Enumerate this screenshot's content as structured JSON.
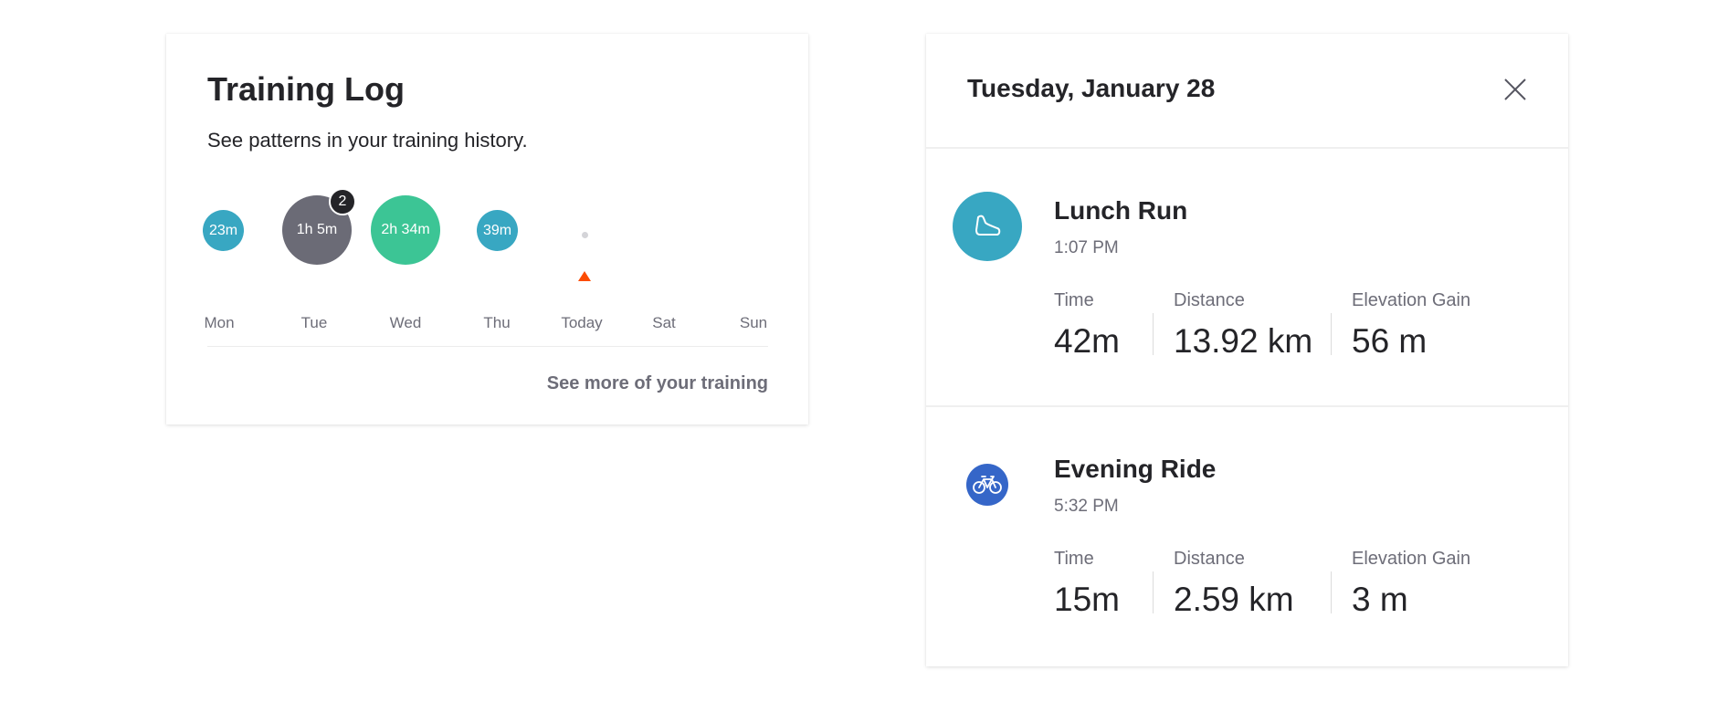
{
  "training_log": {
    "title": "Training Log",
    "subtitle": "See patterns in your training history.",
    "days": [
      {
        "label": "Mon",
        "duration": "23m"
      },
      {
        "label": "Tue",
        "duration": "1h 5m",
        "activity_count": "2"
      },
      {
        "label": "Wed",
        "duration": "2h 34m"
      },
      {
        "label": "Thu",
        "duration": "39m"
      },
      {
        "label": "Today"
      },
      {
        "label": "Sat"
      },
      {
        "label": "Sun"
      }
    ],
    "see_more_label": "See more of your training",
    "colors": {
      "run": "#38a7c2",
      "multi": "#6b6b76",
      "ride_long": "#3cc595",
      "today_marker": "#fc4c02"
    }
  },
  "day_detail": {
    "date": "Tuesday, January 28",
    "close_icon": "close-icon",
    "activities": [
      {
        "name": "Lunch Run",
        "time": "1:07 PM",
        "icon": "shoe-icon",
        "icon_color": "#38a7c2",
        "stats": [
          {
            "label": "Time",
            "value": "42m"
          },
          {
            "label": "Distance",
            "value": "13.92 km"
          },
          {
            "label": "Elevation Gain",
            "value": "56 m"
          }
        ]
      },
      {
        "name": "Evening Ride",
        "time": "5:32 PM",
        "icon": "bicycle-icon",
        "icon_color": "#3566c8",
        "stats": [
          {
            "label": "Time",
            "value": "15m"
          },
          {
            "label": "Distance",
            "value": "2.59 km"
          },
          {
            "label": "Elevation Gain",
            "value": "3 m"
          }
        ]
      }
    ]
  }
}
